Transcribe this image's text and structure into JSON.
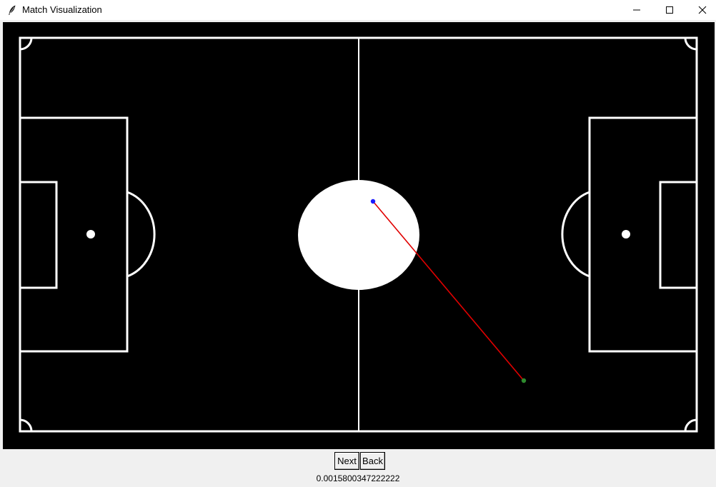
{
  "window": {
    "title": "Match Visualization",
    "icon": "feather-icon"
  },
  "colors": {
    "pitch_background": "#000000",
    "pitch_lines": "#ffffff",
    "pass_line": "#e00000",
    "player_start": "#1a1aff",
    "player_end": "#2e8b2e"
  },
  "controls": {
    "next_label": "Next",
    "back_label": "Back",
    "value_readout": "0.0015800347222222"
  }
}
